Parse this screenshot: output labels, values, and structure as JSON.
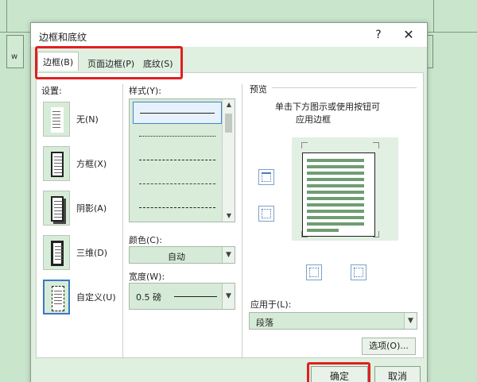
{
  "dialog": {
    "title": "边框和底纹",
    "help": "?",
    "close": "✕"
  },
  "tabs": [
    {
      "label": "边框(B)",
      "active": true
    },
    {
      "label": "页面边框(P)",
      "active": false
    },
    {
      "label": "底纹(S)",
      "active": false
    }
  ],
  "settings": {
    "title": "设置:",
    "items": [
      {
        "label": "无(N)",
        "icon": "setting-none-icon"
      },
      {
        "label": "方框(X)",
        "icon": "setting-box-icon"
      },
      {
        "label": "阴影(A)",
        "icon": "setting-shadow-icon"
      },
      {
        "label": "三维(D)",
        "icon": "setting-3d-icon"
      },
      {
        "label": "自定义(U)",
        "icon": "setting-custom-icon",
        "selected": true
      }
    ]
  },
  "style": {
    "label": "样式(Y):",
    "items": [
      "solid",
      "dotted",
      "dashed-fine",
      "dashed",
      "dash-dot"
    ]
  },
  "color": {
    "label": "颜色(C):",
    "value": "自动"
  },
  "width": {
    "label": "宽度(W):",
    "value": "0.5 磅"
  },
  "preview": {
    "title": "预览",
    "hint_line1": "单击下方图示或使用按钮可",
    "hint_line2": "应用边框"
  },
  "apply": {
    "label": "应用于(L):",
    "value": "段落"
  },
  "options_button": "选项(O)...",
  "footer": {
    "ok": "确定",
    "cancel": "取消"
  },
  "background": {
    "text": "w"
  },
  "colors": {
    "highlight": "#e02020",
    "accent": "#3b78c2",
    "background": "#c9e6cc"
  }
}
